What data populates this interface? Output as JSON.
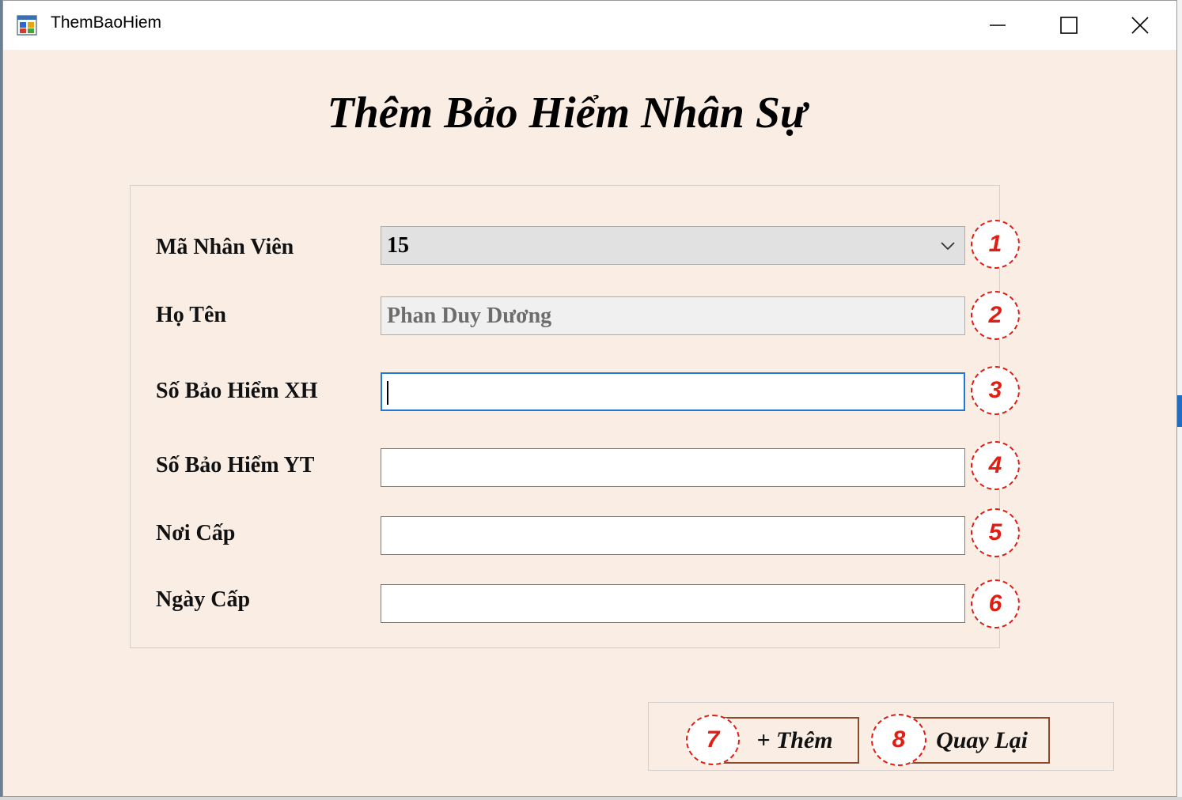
{
  "window": {
    "title": "ThemBaoHiem",
    "icons": [
      "app-icon",
      "minimize-icon",
      "maximize-icon",
      "close-icon"
    ]
  },
  "form": {
    "heading": "Thêm Bảo Hiểm Nhân Sự",
    "fields": [
      {
        "label": "Mã Nhân Viên",
        "value": "15",
        "marker": "1"
      },
      {
        "label": "Họ Tên",
        "value": "Phan Duy Dương",
        "marker": "2"
      },
      {
        "label": "Số Bảo Hiểm XH",
        "value": "",
        "marker": "3"
      },
      {
        "label": "Số Bảo Hiểm YT",
        "value": "",
        "marker": "4"
      },
      {
        "label": "Nơi Cấp",
        "value": "",
        "marker": "5"
      },
      {
        "label": "Ngày Cấp",
        "value": "",
        "marker": "6"
      }
    ]
  },
  "actions": {
    "add_label": "+ Thêm",
    "add_marker": "7",
    "back_label": "Quay Lại",
    "back_marker": "8"
  },
  "colors": {
    "form_background": "#faeee4",
    "marker_red": "#e01e14",
    "button_border": "#8b4a2b",
    "focus_blue": "#1f78d1"
  }
}
